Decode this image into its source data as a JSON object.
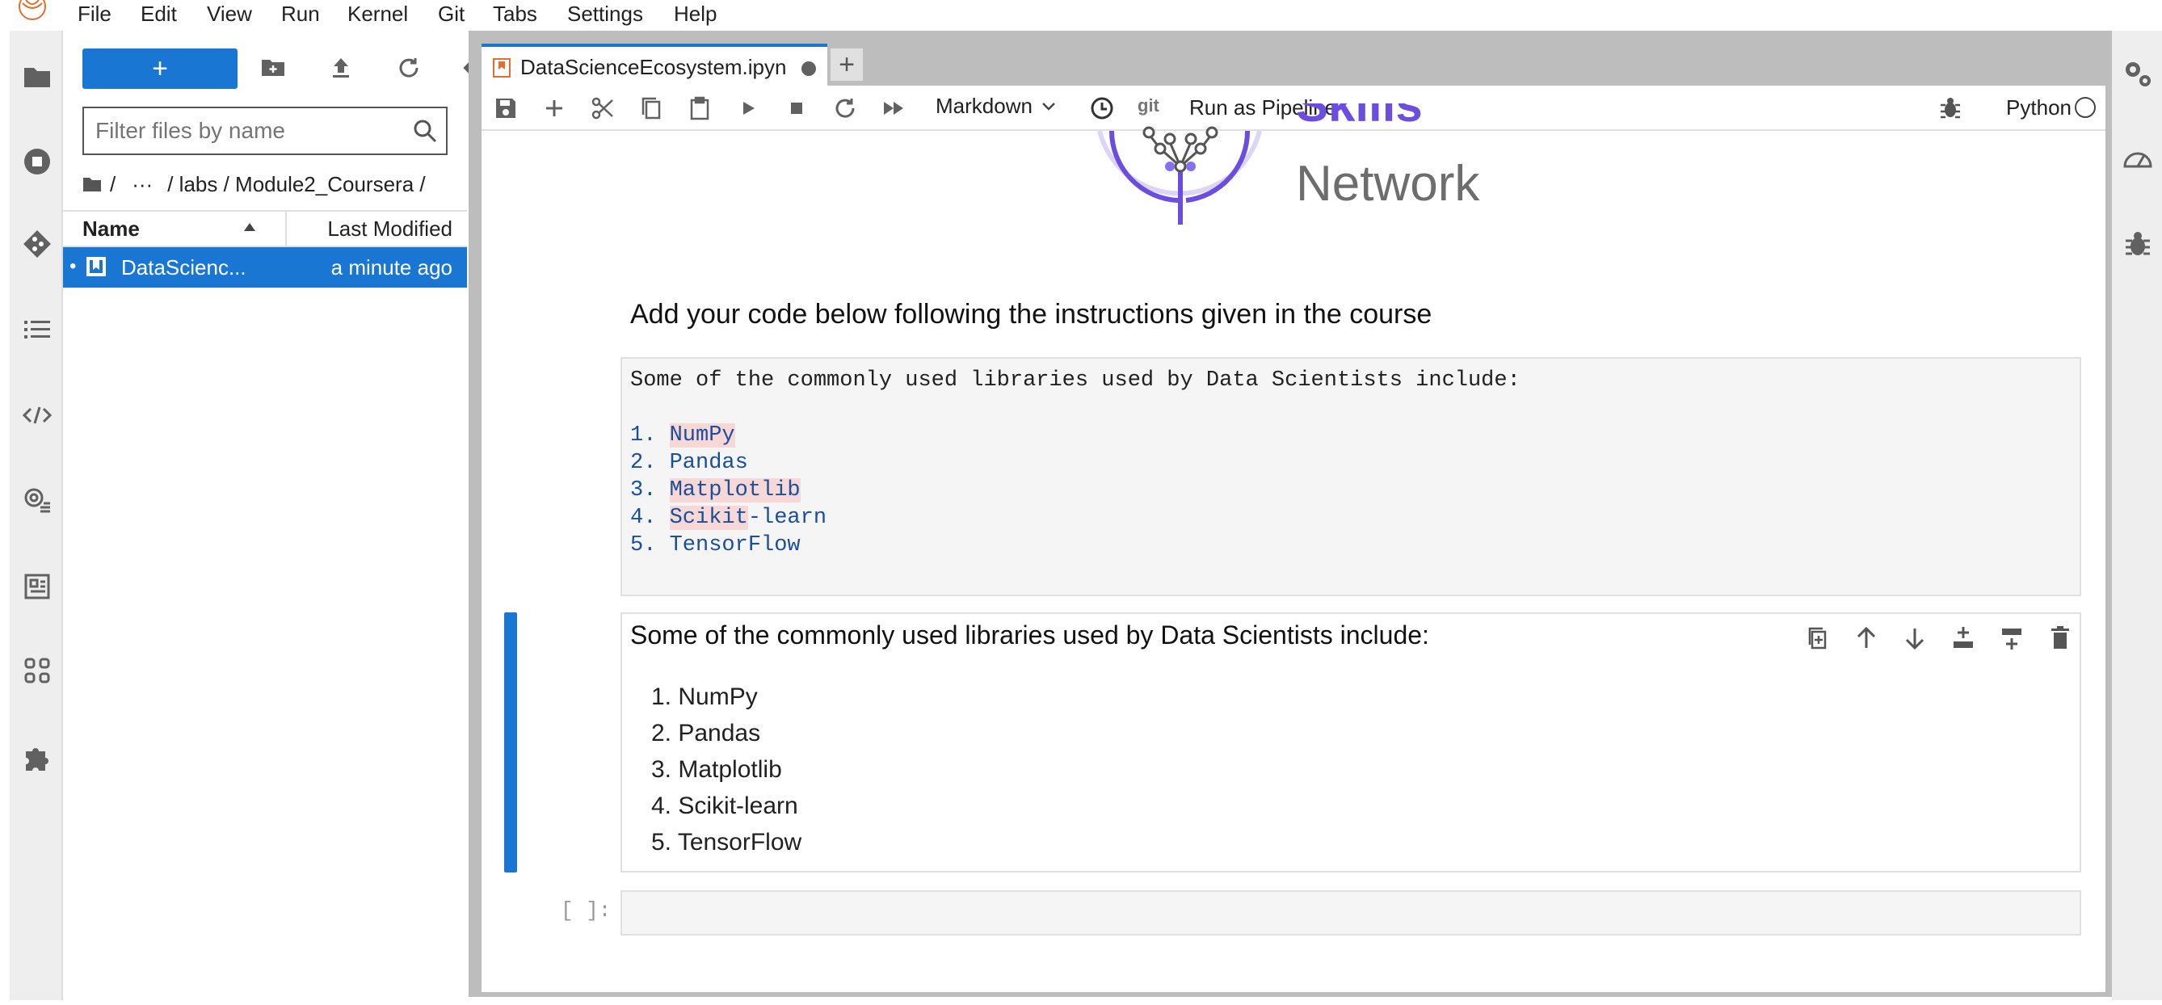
{
  "menu": [
    "File",
    "Edit",
    "View",
    "Run",
    "Kernel",
    "Git",
    "Tabs",
    "Settings",
    "Help"
  ],
  "filebrowser": {
    "new_label": "+",
    "filter_placeholder": "Filter files by name",
    "breadcrumb": {
      "root": "/",
      "ellipsis": "···",
      "path": "/ labs / Module2_Coursera /"
    },
    "columns": {
      "name": "Name",
      "modified": "Last Modified"
    },
    "files": [
      {
        "name": "DataScienc...",
        "modified": "a minute ago"
      }
    ]
  },
  "tab": {
    "title": "DataScienceEcosystem.ipyn",
    "add": "+"
  },
  "toolbar": {
    "cell_type": "Markdown",
    "git": "git",
    "pipeline": "Run as Pipeline",
    "kernel": "Python"
  },
  "logo": {
    "line1": "Skills",
    "line2": "Network"
  },
  "instruction": "Add your code below following the instructions given in the course",
  "raw_cell": {
    "intro": "Some of the commonly used libraries used by Data Scientists include:",
    "items": [
      {
        "num": "1. ",
        "hl": "NumPy",
        "rest": ""
      },
      {
        "num": "2. ",
        "hl": "",
        "rest": "Pandas"
      },
      {
        "num": "3. ",
        "hl": "Matplotlib",
        "rest": ""
      },
      {
        "num": "4. ",
        "hl": "Scikit",
        "rest": "-learn"
      },
      {
        "num": "5. ",
        "hl": "",
        "rest": "TensorFlow"
      }
    ]
  },
  "md_cell": {
    "heading": "Some of the commonly used libraries used by Data Scientists include:",
    "items": [
      "1. NumPy",
      "2. Pandas",
      "3. Matplotlib",
      "4. Scikit-learn",
      "5. TensorFlow"
    ]
  },
  "empty_cell": {
    "prompt": "[ ]:"
  },
  "colors": {
    "accent": "#1976d2",
    "brand": "#6c4de0",
    "highlight": "#f8d7d7"
  }
}
